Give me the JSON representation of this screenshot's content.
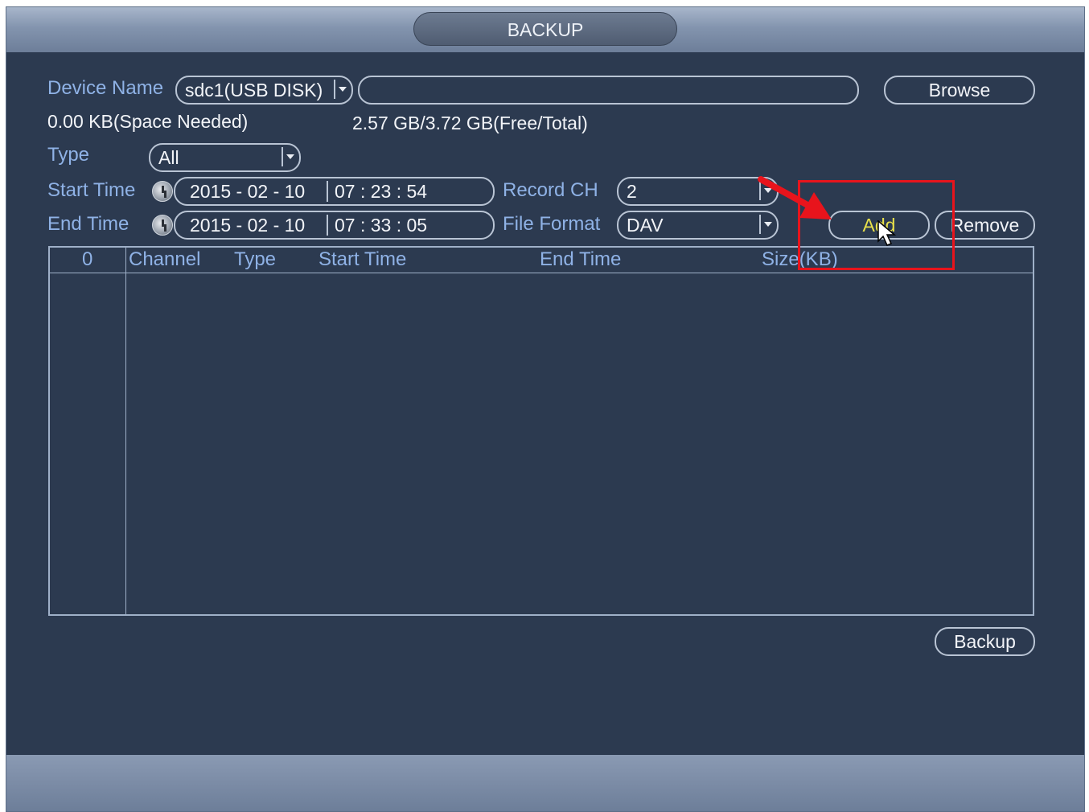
{
  "window": {
    "title": "BACKUP"
  },
  "device": {
    "label": "Device Name",
    "selected": "sdc1(USB DISK)",
    "path_value": "",
    "browse_label": "Browse"
  },
  "space": {
    "needed": "0.00 KB(Space Needed)",
    "free_total": "2.57 GB/3.72 GB(Free/Total)"
  },
  "type": {
    "label": "Type",
    "selected": "All"
  },
  "start_time": {
    "label": "Start Time",
    "date": "2015 - 02 - 10",
    "time": "07 : 23 : 54"
  },
  "end_time": {
    "label": "End Time",
    "date": "2015 - 02 - 10",
    "time": "07 : 33 : 05"
  },
  "record_ch": {
    "label": "Record CH",
    "selected": "2"
  },
  "file_format": {
    "label": "File Format",
    "selected": "DAV"
  },
  "actions": {
    "add_label": "Add",
    "remove_label": "Remove",
    "backup_label": "Backup"
  },
  "table": {
    "columns": [
      "0",
      "Channel",
      "Type",
      "Start Time",
      "End Time",
      "Size(KB)"
    ],
    "rows": []
  },
  "colors": {
    "background": "#2c3a50",
    "label": "#8fb2e6",
    "text": "#f2f4f8",
    "add_text": "#e8e04a",
    "annotation": "#e8141c"
  },
  "icons": {
    "clock": "clock-icon",
    "dropdown": "chevron-down-icon",
    "cursor": "mouse-pointer-icon",
    "annotation_arrow": "red-arrow-icon"
  }
}
